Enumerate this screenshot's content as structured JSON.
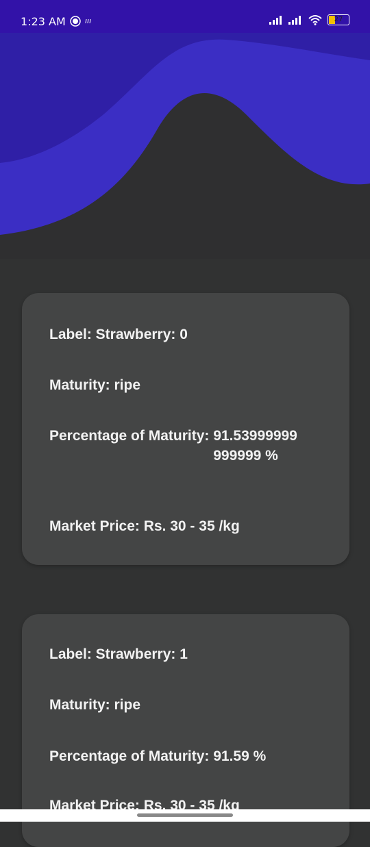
{
  "status_bar": {
    "time": "1:23 AM",
    "battery": "27"
  },
  "colors": {
    "status_bar": "#3212a8",
    "wave_dark": "#2f1fa6",
    "wave_light": "#3b2ec4",
    "background": "#313232",
    "card": "#444545"
  },
  "results": [
    {
      "label": "Label: Strawberry: 0",
      "maturity": "Maturity: ripe",
      "percentage_label": "Percentage of Maturity:",
      "percentage_value": "91.53999999999999",
      "percentage_unit": "%",
      "market_price": "Market Price: Rs. 30 - 35 /kg"
    },
    {
      "label": "Label: Strawberry: 1",
      "maturity": "Maturity: ripe",
      "percentage_label": "Percentage of Maturity:",
      "percentage_value": "91.59",
      "percentage_unit": "%",
      "market_price": "Market Price: Rs. 30 - 35 /kg"
    }
  ]
}
